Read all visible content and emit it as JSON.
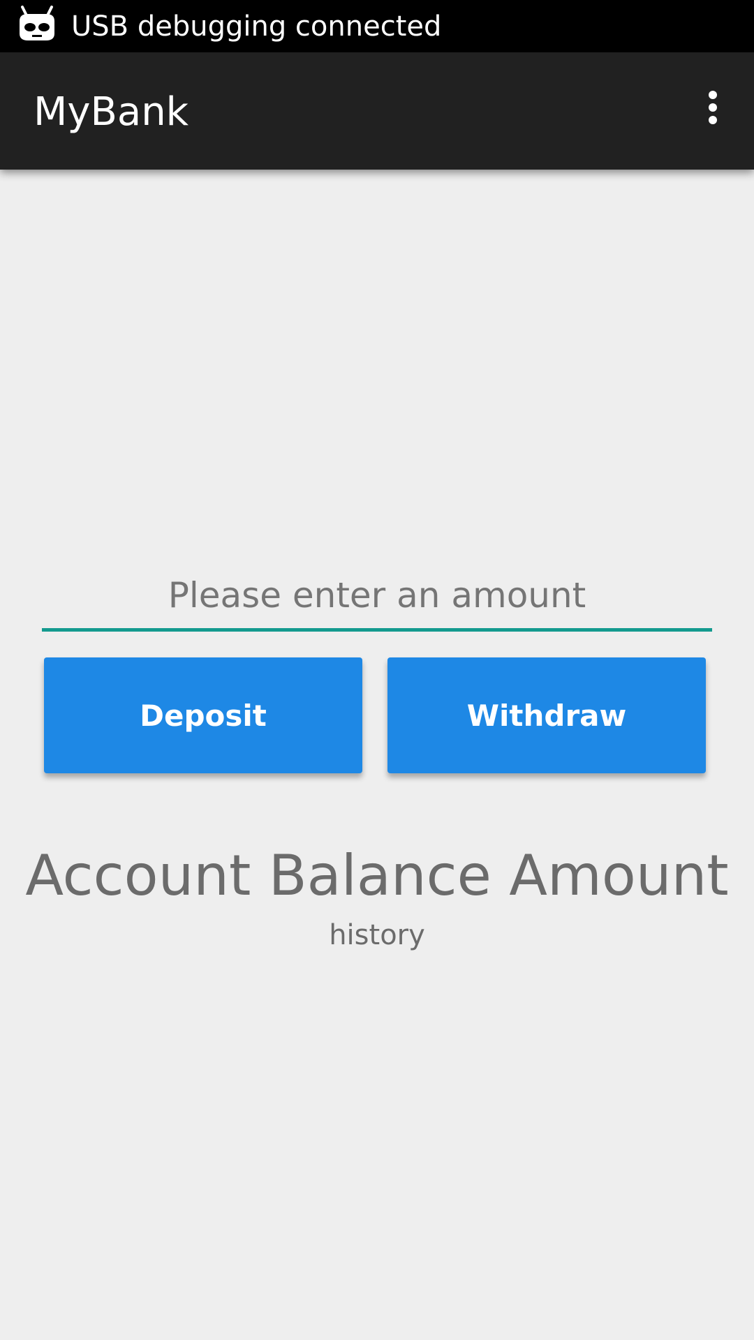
{
  "status_bar": {
    "notification_icon": "cyanogen-mascot-icon",
    "text": "USB debugging connected"
  },
  "app_bar": {
    "title": "MyBank",
    "overflow_icon": "more-vert-icon"
  },
  "amount_input": {
    "placeholder": "Please enter an amount",
    "value": ""
  },
  "buttons": {
    "deposit_label": "Deposit",
    "withdraw_label": "Withdraw"
  },
  "balance": {
    "text": "Account Balance Amount",
    "history_text": "history"
  },
  "colors": {
    "status_bar": "#000000",
    "app_bar": "#212121",
    "background": "#eeeeee",
    "button": "#1e88e5",
    "input_underline": "#139a8e",
    "text_gray": "#6b6b6b"
  }
}
